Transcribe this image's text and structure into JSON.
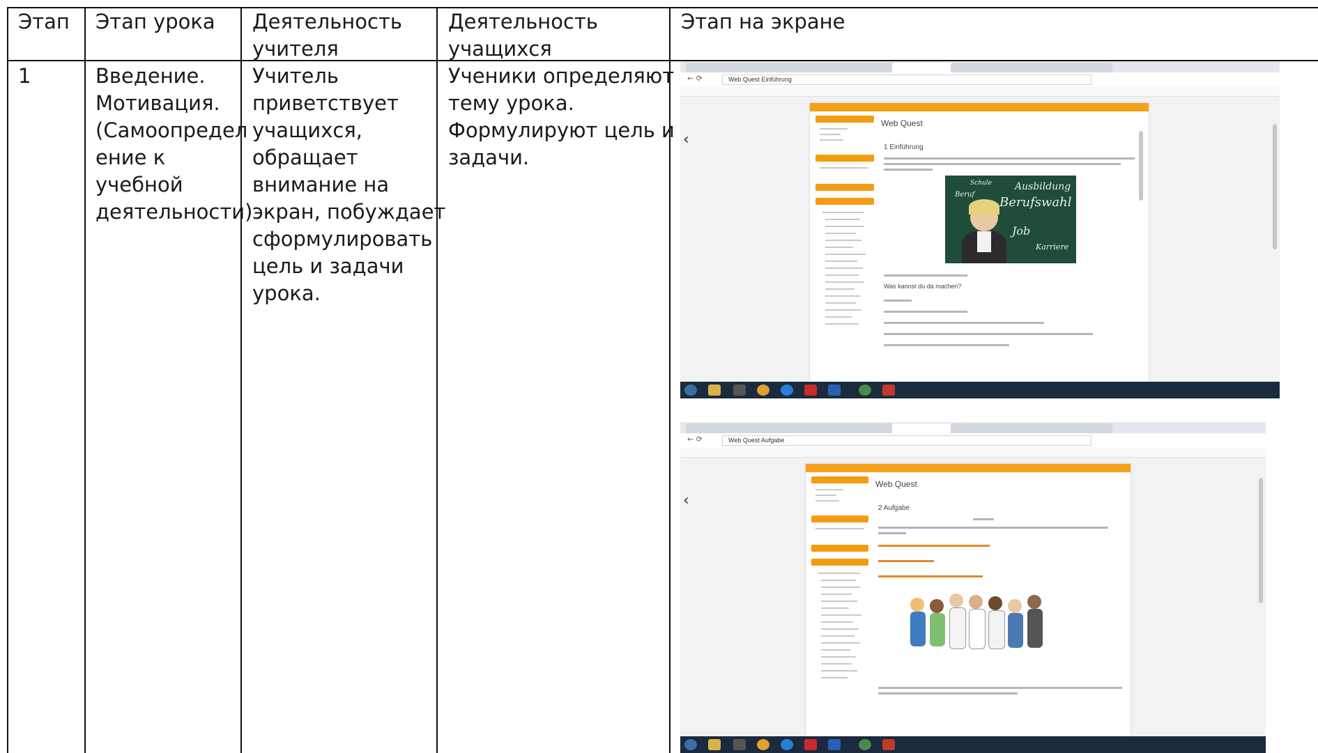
{
  "table": {
    "headers": [
      "Этап",
      "Этап урока",
      "Деятельность\nучителя",
      "Деятельность\nучащихся",
      "Этап на экране"
    ],
    "row": {
      "stage": "1",
      "lesson_stage": "Введение.\nМотивация.\n(Самоопредел\nение к\nучебной\nдеятельности)",
      "teacher": "Учитель\nприветствует\nучащихся,\nобращает\nвнимание на\nэкран, побуждает\nсформулировать\nцель и задачи\nурока.",
      "students": "Ученики определяют\nтему урока.\nФормулируют цель и\nзадачи."
    }
  },
  "screenshot1": {
    "url": "Web Quest Einführung",
    "page_title": "Web Quest",
    "section": "1 Einführung",
    "question": "Was kannst du da machen?",
    "board_words": [
      "Ausbildung",
      "Berufswahl",
      "Job",
      "Karriere",
      "Schule",
      "Beruf"
    ]
  },
  "screenshot2": {
    "url": "Web Quest Aufgabe",
    "page_title": "Web Quest",
    "section": "2 Aufgabe"
  },
  "colors": {
    "accent": "#f39c12",
    "taskbar": "#1c2a3d",
    "board": "#1f4d3a"
  }
}
